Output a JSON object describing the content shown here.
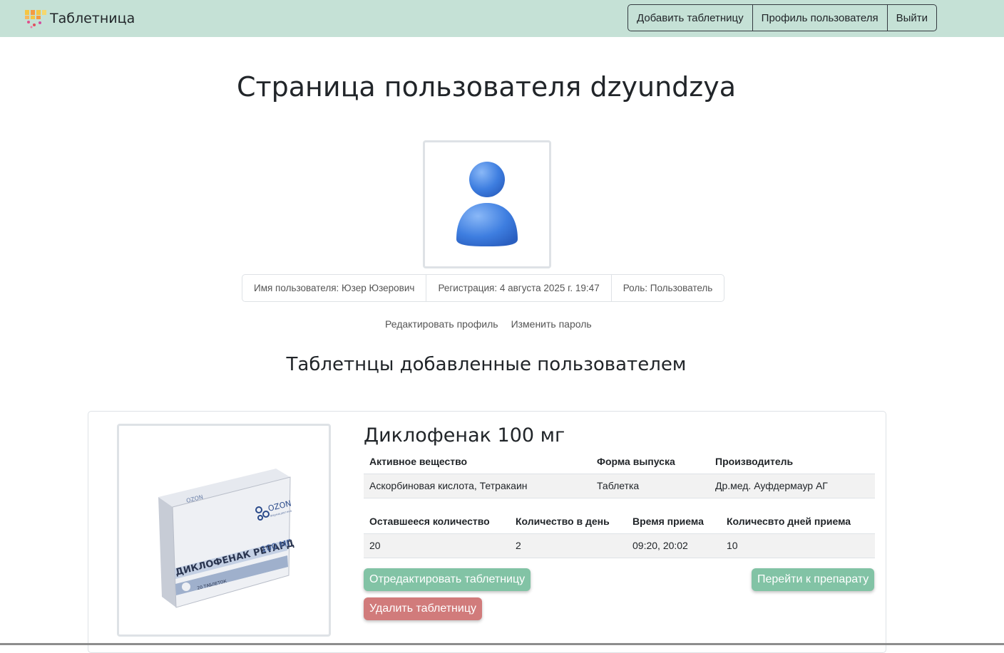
{
  "navbar": {
    "brand": "Таблетница",
    "buttons": [
      "Добавить таблетницу",
      "Профиль пользователя",
      "Выйти"
    ],
    "background": "#c5e1d6"
  },
  "profile": {
    "title": "Страница пользователя dzyundzya",
    "avatar_icon": "user-icon",
    "info": [
      "Имя пользователя: Юзер Юзерович",
      "Регистрация: 4 августа 2025 г. 19:47",
      "Роль: Пользователь"
    ],
    "links": [
      "Редактировать профиль",
      "Изменить пароль"
    ]
  },
  "section_title": "Таблетнцы добавленные пользователем",
  "card": {
    "drug_name": "Диклофенак 100 мг",
    "image": {
      "pack_title": "ДИКЛОФЕНАК РЕТАРД",
      "pack_dose": "100 МГ",
      "pack_count": "20 ТАБЛЕТОК",
      "pack_brand": "OZON",
      "pack_brand_sub": "Фармацевтика"
    },
    "info_table": {
      "headers": [
        "Активное вещество",
        "Форма выпуска",
        "Производитель"
      ],
      "row": [
        "Аскорбиновая кислота, Тетракаин",
        "Таблетка",
        "Др.мед. Ауфдермаур АГ"
      ]
    },
    "schedule_table": {
      "headers": [
        "Оставшееся количество",
        "Количество в день",
        "Время приема",
        "Количесвто дней приема"
      ],
      "row": [
        "20",
        "2",
        "09:20, 20:02",
        "10"
      ]
    },
    "buttons": {
      "edit": "Отредактировать таблетницу",
      "goto": "Перейти к препарату",
      "delete": "Удалить таблетницу"
    },
    "colors": {
      "primary_btn": "#82c3a5",
      "danger_btn": "#d17b7b"
    }
  }
}
